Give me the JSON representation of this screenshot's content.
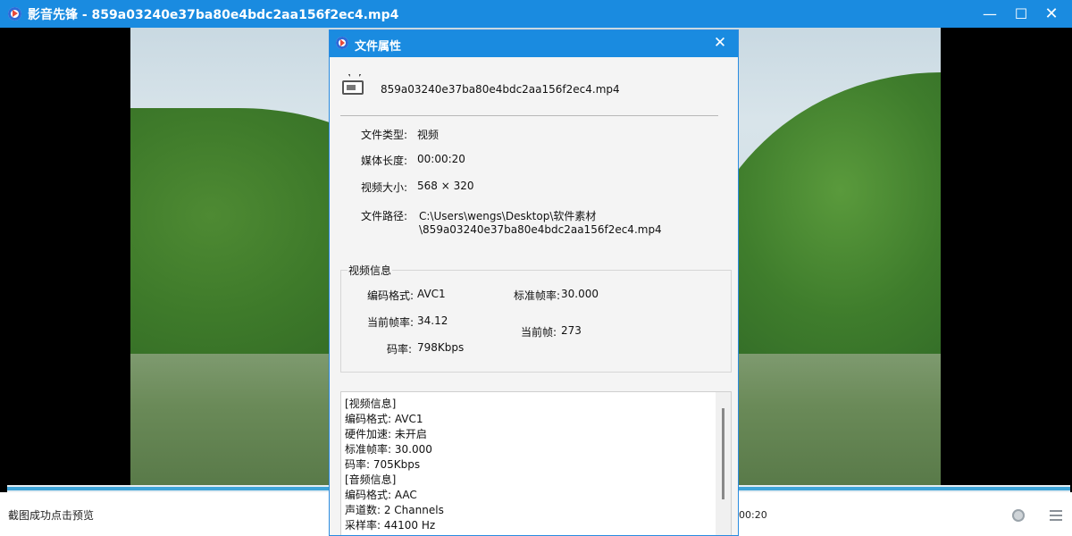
{
  "window": {
    "app_name": "影音先锋",
    "title": "影音先锋 - 859a03240e37ba80e4bdc2aa156f2ec4.mp4",
    "minimize_glyph": "—",
    "maximize_glyph": "☐",
    "close_glyph": "✕"
  },
  "status": {
    "message": "截图成功点击预览",
    "time": "00:20"
  },
  "dialog": {
    "title": "文件属性",
    "close_glyph": "✕",
    "file_name": "859a03240e37ba80e4bdc2aa156f2ec4.mp4",
    "props": {
      "type_label": "文件类型:",
      "type_value": "视频",
      "duration_label": "媒体长度:",
      "duration_value": "00:00:20",
      "size_label": "视频大小:",
      "size_value": "568 × 320",
      "path_label": "文件路径:",
      "path_line1": "C:\\Users\\wengs\\Desktop\\软件素材",
      "path_line2": "\\859a03240e37ba80e4bdc2aa156f2ec4.mp4"
    },
    "video_info": {
      "group_title": "视频信息",
      "codec_label": "编码格式:",
      "codec_value": "AVC1",
      "std_fps_label": "标准帧率:",
      "std_fps_value": "30.000",
      "cur_fps_label": "当前帧率:",
      "cur_fps_value": "34.12",
      "cur_frame_label": "当前帧:",
      "cur_frame_value": "273",
      "bitrate_label": "码率:",
      "bitrate_value": "798Kbps"
    },
    "details": [
      "[视频信息]",
      "编码格式:   AVC1",
      "硬件加速:   未开启",
      "标准帧率:   30.000",
      "码率:   705Kbps",
      "[音频信息]",
      "编码格式:   AAC",
      "声道数:   2 Channels",
      "采样率:   44100 Hz"
    ]
  },
  "colors": {
    "titlebar": "#1a8be0",
    "progress": "#3ea4d8"
  }
}
